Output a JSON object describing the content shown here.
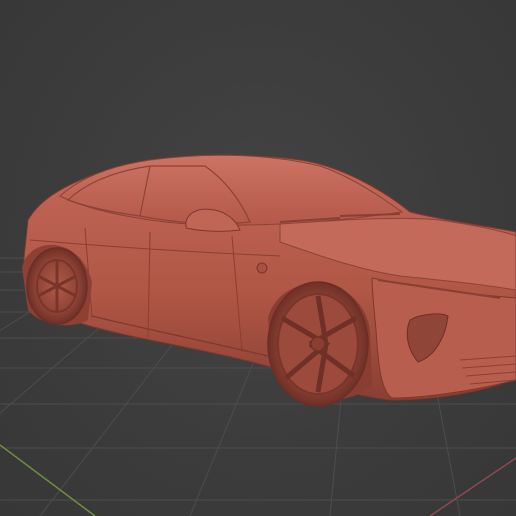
{
  "viewport": {
    "mode": "solid-shading",
    "colors": {
      "background": "#3d3d3d",
      "grid": "#505050",
      "x_axis": "#8c4a52",
      "y_axis": "#6f8f3c",
      "model": "#b45a4a"
    }
  },
  "scene_object": {
    "type": "car-3d-model"
  }
}
